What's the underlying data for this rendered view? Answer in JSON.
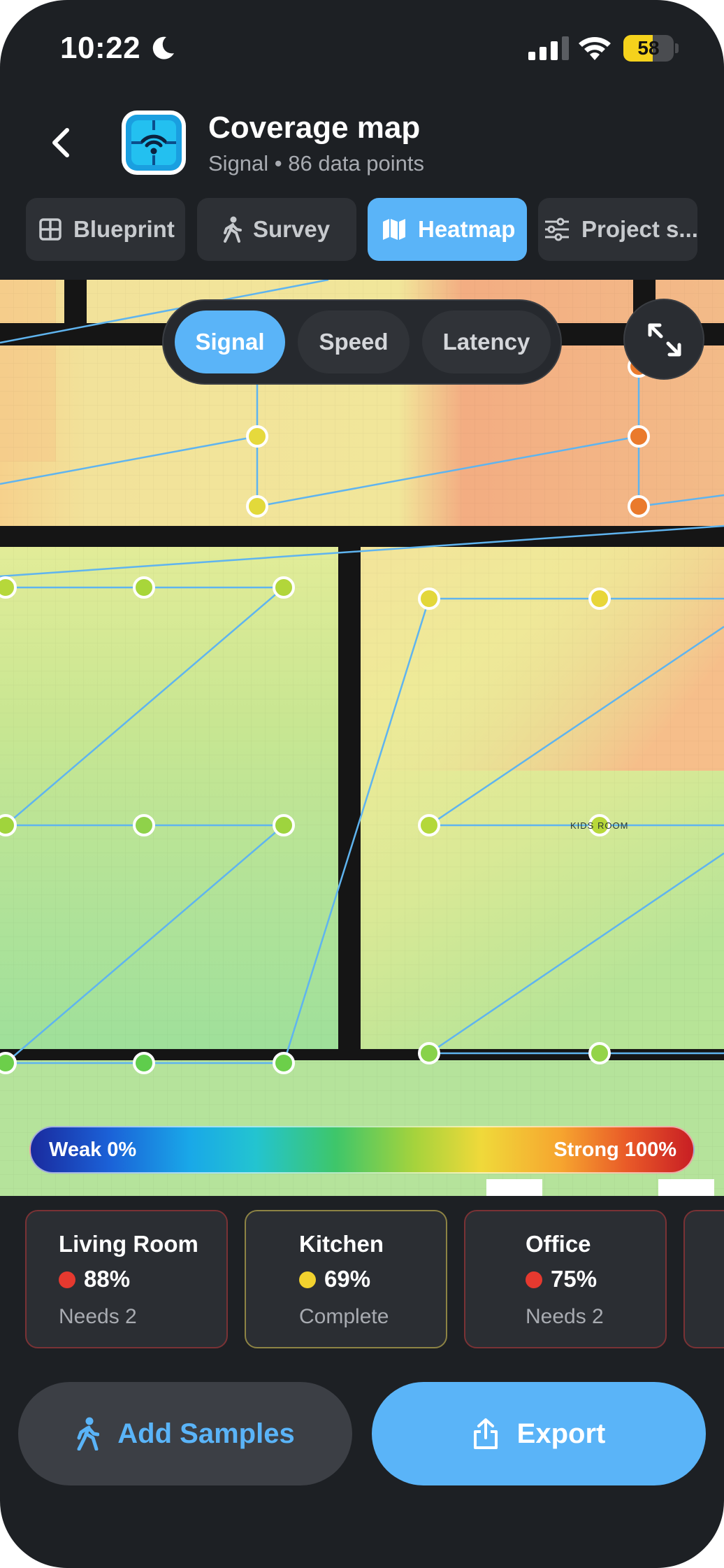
{
  "status_bar": {
    "time": "10:22",
    "battery": "58",
    "battery_level": 0.58,
    "focus_icon": "moon-icon",
    "signal_icon": "cellular-bars-icon",
    "wifi_icon": "wifi-icon"
  },
  "header": {
    "back_icon": "chevron-left-icon",
    "app_icon": "wifi-router-icon",
    "title": "Coverage map",
    "subtitle": "Signal • 86 data points"
  },
  "tabs": [
    {
      "label": "Blueprint",
      "icon": "grid-icon",
      "active": false
    },
    {
      "label": "Survey",
      "icon": "walking-icon",
      "active": false
    },
    {
      "label": "Heatmap",
      "icon": "map-icon",
      "active": true
    },
    {
      "label": "Project s...",
      "icon": "sliders-icon",
      "active": false
    }
  ],
  "metric_toggle": {
    "options": [
      "Signal",
      "Speed",
      "Latency"
    ],
    "selected": "Signal"
  },
  "map": {
    "expand_icon": "expand-arrows-icon",
    "room_labels": [
      "KIDS ROOM"
    ],
    "legend": {
      "min_label": "Weak 0%",
      "max_label": "Strong 100%"
    },
    "colors": {
      "wall": "#151515",
      "path": "#5fb4ef",
      "strong": "#e95a28",
      "medium": "#e8d83a",
      "good": "#8fd24a"
    }
  },
  "rooms": [
    {
      "name": "Living Room",
      "value": "88%",
      "status": "Needs 2",
      "dot_color": "#e5392f"
    },
    {
      "name": "Kitchen",
      "value": "69%",
      "status": "Complete",
      "dot_color": "#f2d22e"
    },
    {
      "name": "Office",
      "value": "75%",
      "status": "Needs 2",
      "dot_color": "#e5392f"
    }
  ],
  "actions": {
    "add_samples": "Add Samples",
    "add_samples_icon": "walking-icon",
    "export": "Export",
    "export_icon": "share-icon"
  }
}
